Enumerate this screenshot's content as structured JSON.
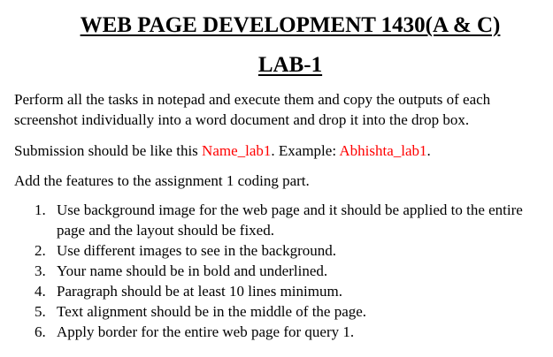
{
  "document": {
    "title": "WEB PAGE DEVELOPMENT 1430(A & C)",
    "subtitle": "LAB-1",
    "intro": "Perform all the tasks in notepad and execute them and copy the outputs of each screenshot individually into a word document and drop it into the drop box.",
    "submission": {
      "prefix": "Submission should be like this ",
      "format": "Name_lab1",
      "middle": ". Example:  ",
      "example": "Abhishta_lab1",
      "suffix": "."
    },
    "features_intro": "Add the features to the assignment 1 coding part.",
    "tasks": [
      {
        "num": "1.",
        "text": "Use background image for the web page and it should be applied to the entire page and the layout should be fixed."
      },
      {
        "num": "2.",
        "text": "Use different images to see in the background."
      },
      {
        "num": "3.",
        "text": "Your name should be in bold and underlined."
      },
      {
        "num": "4.",
        "text": "Paragraph should be at least 10 lines minimum."
      },
      {
        "num": "5.",
        "text": "Text alignment should be in the middle of the page."
      },
      {
        "num": "6.",
        "text": "Apply border for the entire web page for query 1."
      }
    ]
  },
  "colors": {
    "text": "#000000",
    "highlight": "#ff0000",
    "background": "#ffffff"
  }
}
